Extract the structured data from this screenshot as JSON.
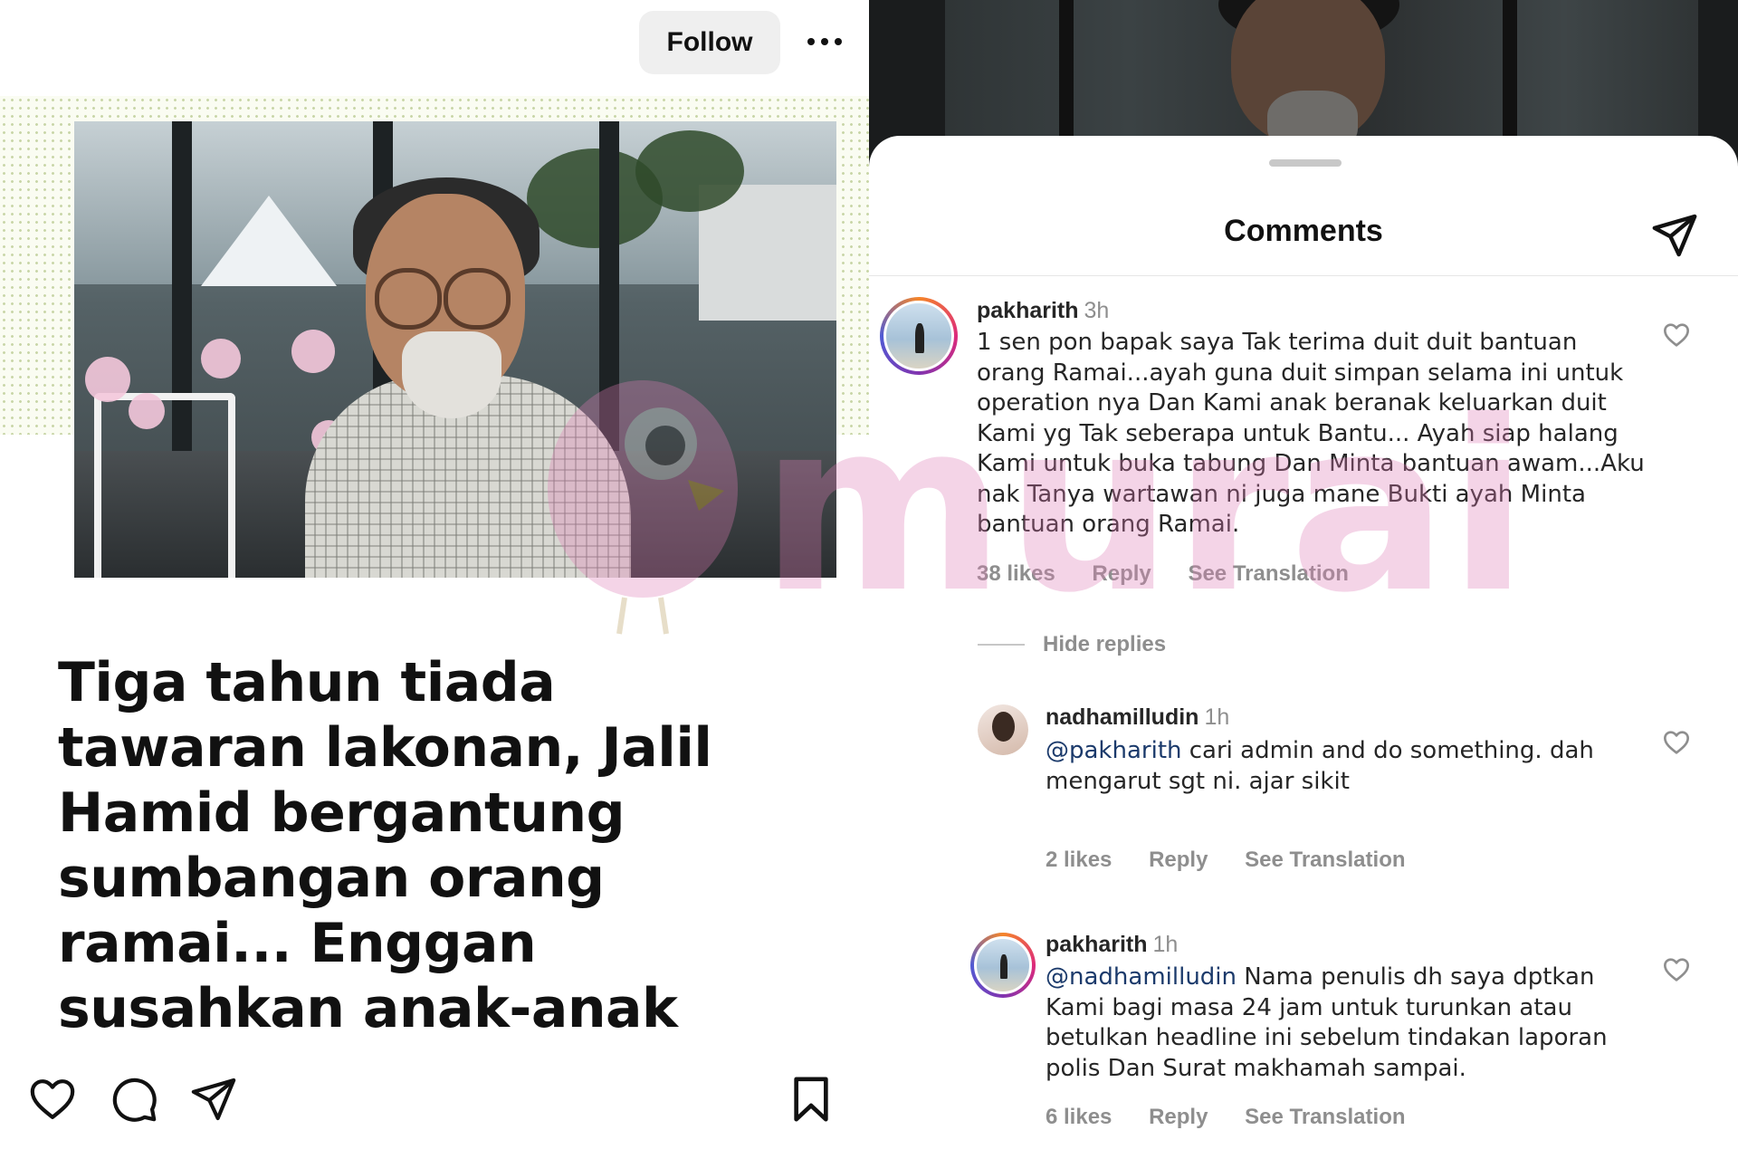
{
  "post": {
    "follow_label": "Follow",
    "headline": "Tiga tahun tiada tawaran lakonan, Jalil Hamid bergantung sumbangan orang ramai... Enggan susahkan anak-anak"
  },
  "icons": {
    "more": "more-options-icon",
    "like": "heart-icon",
    "comment": "comment-icon",
    "share": "paper-plane-icon",
    "save": "bookmark-icon",
    "send": "paper-plane-icon"
  },
  "comments_sheet": {
    "title": "Comments",
    "hide_replies_label": "Hide replies",
    "comments": [
      {
        "username": "pakharith",
        "time": "3h",
        "mention": "",
        "text": "1 sen pon bapak saya Tak terima duit duit bantuan orang Ramai...ayah guna duit simpan selama ini untuk operation nya Dan Kami anak beranak keluarkan duit Kami yg Tak seberapa untuk Bantu... Ayah siap halang Kami untuk buka tabung Dan Minta bantuan awam...Aku nak Tanya wartawan ni juga mane Bukti ayah Minta bantuan orang Ramai.",
        "likes": "38 likes",
        "reply_label": "Reply",
        "translation_label": "See Translation"
      },
      {
        "username": "nadhamilludin",
        "time": "1h",
        "mention": "@pakharith",
        "text": " cari admin and do something. dah mengarut sgt ni. ajar sikit",
        "likes": "2 likes",
        "reply_label": "Reply",
        "translation_label": "See Translation"
      },
      {
        "username": "pakharith",
        "time": "1h",
        "mention": "@nadhamilludin",
        "text": " Nama penulis dh saya dptkan Kami bagi masa 24 jam untuk turunkan atau betulkan headline ini  sebelum tindakan laporan polis Dan Surat makhamah sampai.",
        "likes": "6 likes",
        "reply_label": "Reply",
        "translation_label": "See Translation"
      }
    ]
  },
  "watermark": {
    "text": "murai",
    "color": "#e07cb6"
  }
}
